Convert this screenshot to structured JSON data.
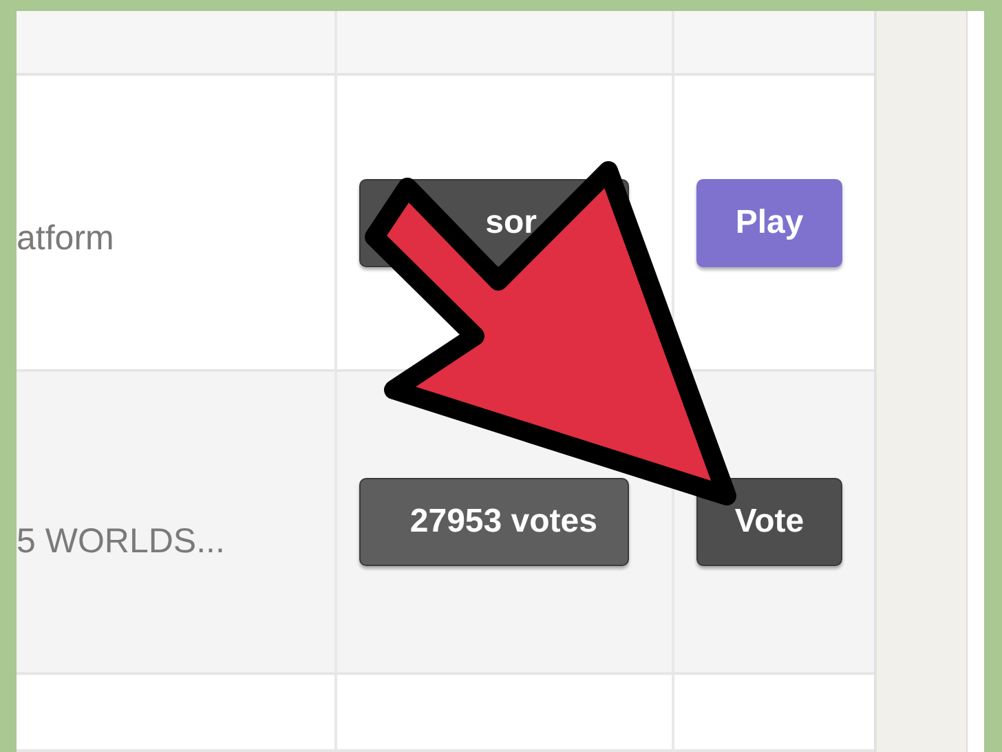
{
  "table": {
    "rows": [
      {
        "title": "atform",
        "buttons": [
          {
            "label": "sor",
            "kind": "dark"
          },
          {
            "label": "Play",
            "kind": "purple"
          }
        ]
      },
      {
        "title": "5 WORLDS...",
        "buttons": [
          {
            "label": "27953 votes",
            "kind": "gray"
          },
          {
            "label": "Vote",
            "kind": "dark"
          }
        ]
      }
    ]
  }
}
